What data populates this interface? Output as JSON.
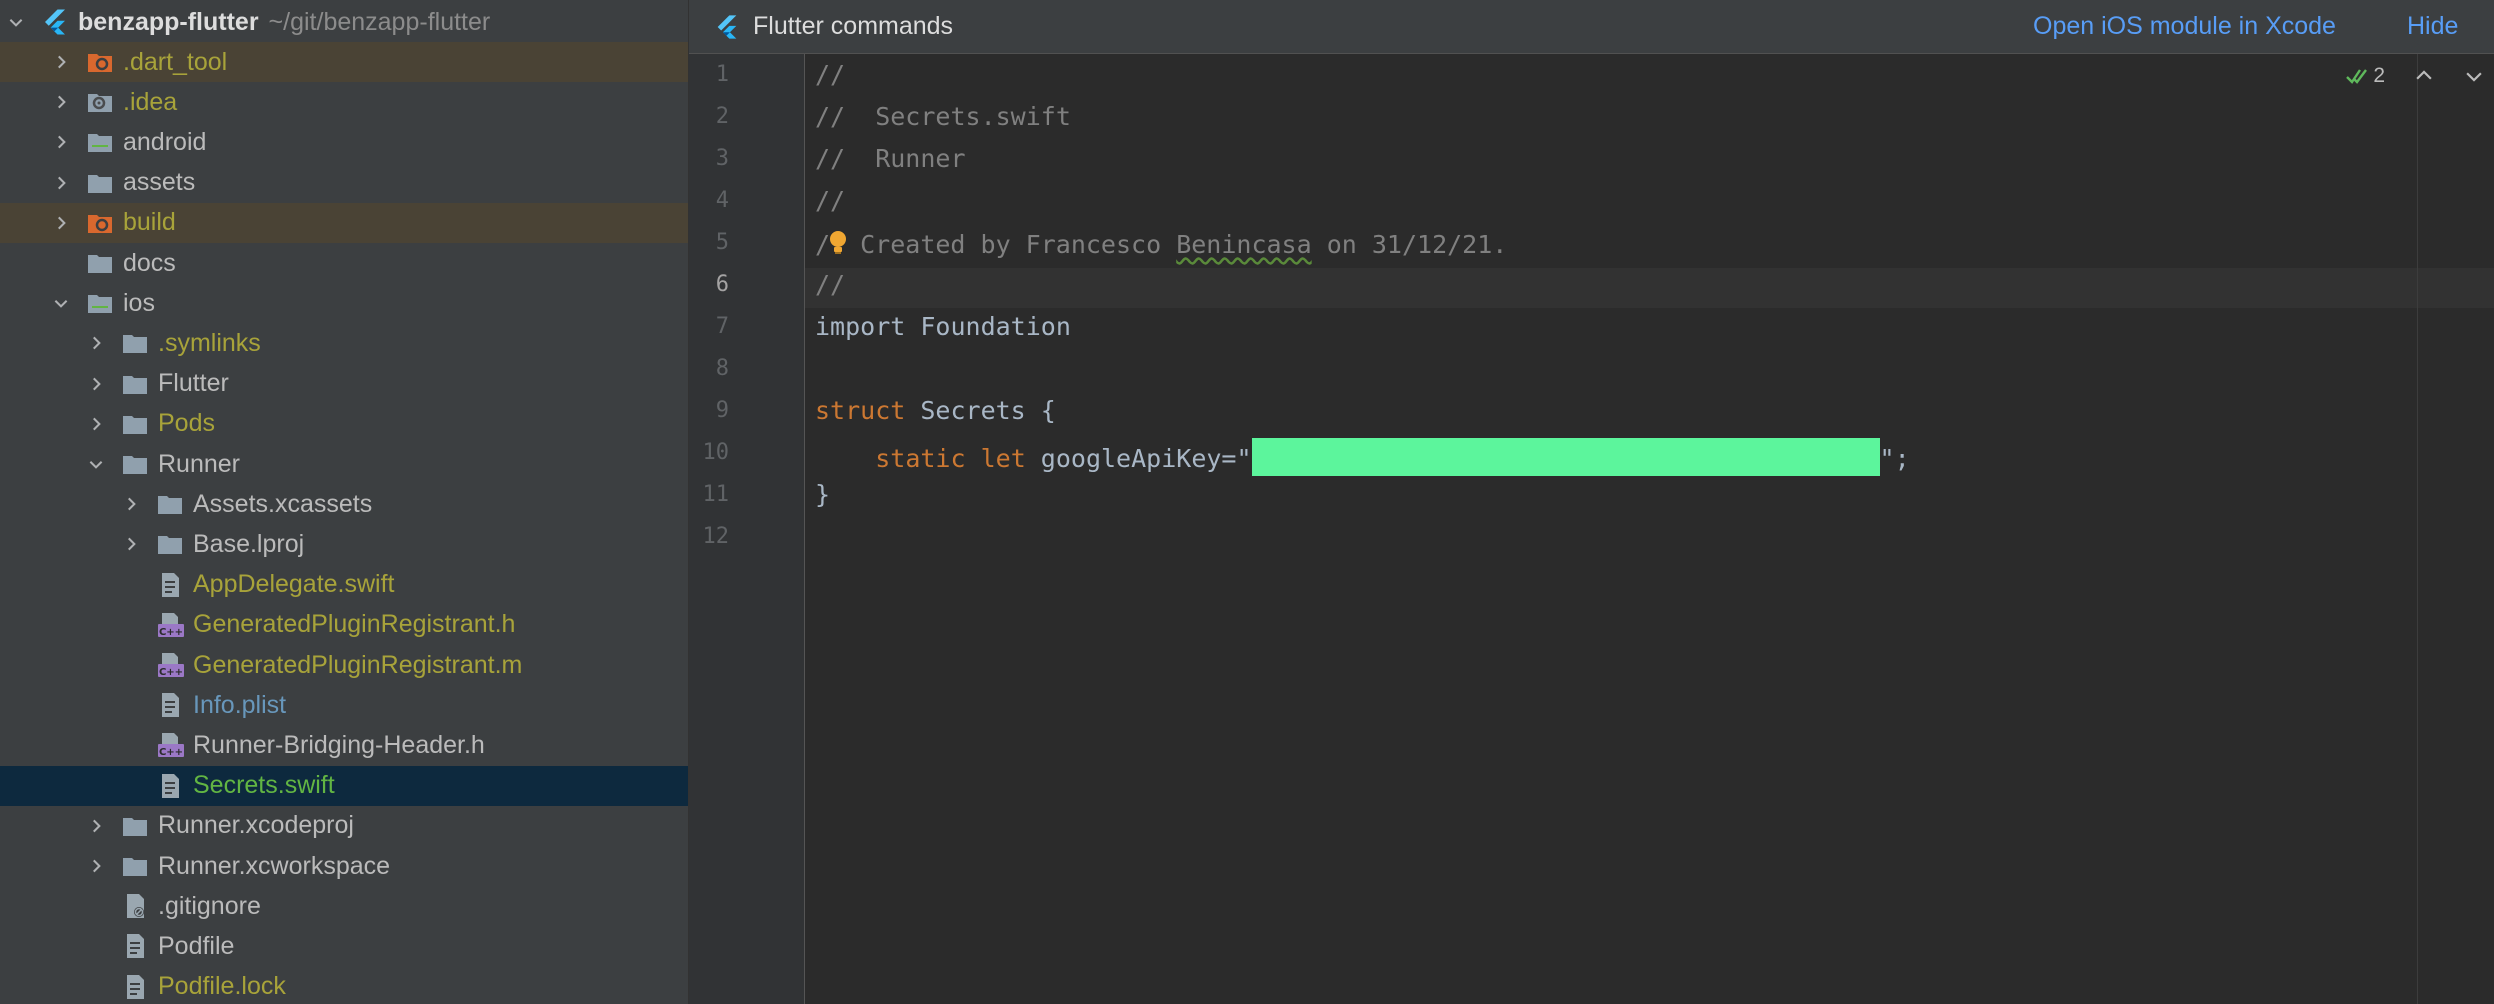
{
  "project": {
    "name": "benzapp-flutter",
    "path": "~/git/benzapp-flutter"
  },
  "tree": [
    {
      "label": ".dart_tool",
      "depth": 1,
      "arrow": "right",
      "icon": "folder-excluded-icon",
      "color": "yellow",
      "ignored": true
    },
    {
      "label": ".idea",
      "depth": 1,
      "arrow": "right",
      "icon": "folder-settings-icon",
      "color": "yellow"
    },
    {
      "label": "android",
      "depth": 1,
      "arrow": "right",
      "icon": "folder-module-icon",
      "color": "default"
    },
    {
      "label": "assets",
      "depth": 1,
      "arrow": "right",
      "icon": "folder-icon",
      "color": "default"
    },
    {
      "label": "build",
      "depth": 1,
      "arrow": "right",
      "icon": "folder-excluded-icon",
      "color": "yellow",
      "ignored": true
    },
    {
      "label": "docs",
      "depth": 1,
      "arrow": "none",
      "icon": "folder-icon",
      "color": "default"
    },
    {
      "label": "ios",
      "depth": 1,
      "arrow": "down",
      "icon": "folder-module-icon",
      "color": "default"
    },
    {
      "label": ".symlinks",
      "depth": 2,
      "arrow": "right",
      "icon": "folder-icon",
      "color": "yellow"
    },
    {
      "label": "Flutter",
      "depth": 2,
      "arrow": "right",
      "icon": "folder-icon",
      "color": "default"
    },
    {
      "label": "Pods",
      "depth": 2,
      "arrow": "right",
      "icon": "folder-icon",
      "color": "yellow"
    },
    {
      "label": "Runner",
      "depth": 2,
      "arrow": "down",
      "icon": "folder-icon",
      "color": "default"
    },
    {
      "label": "Assets.xcassets",
      "depth": 3,
      "arrow": "right",
      "icon": "folder-icon",
      "color": "default"
    },
    {
      "label": "Base.lproj",
      "depth": 3,
      "arrow": "right",
      "icon": "folder-icon",
      "color": "default"
    },
    {
      "label": "AppDelegate.swift",
      "depth": 3,
      "arrow": "none",
      "icon": "file-icon",
      "color": "yellow"
    },
    {
      "label": "GeneratedPluginRegistrant.h",
      "depth": 3,
      "arrow": "none",
      "icon": "cpp-file-icon",
      "color": "yellow"
    },
    {
      "label": "GeneratedPluginRegistrant.m",
      "depth": 3,
      "arrow": "none",
      "icon": "cpp-file-icon",
      "color": "yellow"
    },
    {
      "label": "Info.plist",
      "depth": 3,
      "arrow": "none",
      "icon": "file-icon",
      "color": "blue"
    },
    {
      "label": "Runner-Bridging-Header.h",
      "depth": 3,
      "arrow": "none",
      "icon": "cpp-file-icon",
      "color": "default"
    },
    {
      "label": "Secrets.swift",
      "depth": 3,
      "arrow": "none",
      "icon": "file-icon",
      "color": "green",
      "selected": true
    },
    {
      "label": "Runner.xcodeproj",
      "depth": 2,
      "arrow": "right",
      "icon": "folder-icon",
      "color": "default"
    },
    {
      "label": "Runner.xcworkspace",
      "depth": 2,
      "arrow": "right",
      "icon": "folder-icon",
      "color": "default"
    },
    {
      "label": ".gitignore",
      "depth": 2,
      "arrow": "none",
      "icon": "gitignore-file-icon",
      "color": "default"
    },
    {
      "label": "Podfile",
      "depth": 2,
      "arrow": "none",
      "icon": "file-icon",
      "color": "default"
    },
    {
      "label": "Podfile.lock",
      "depth": 2,
      "arrow": "none",
      "icon": "file-icon",
      "color": "yellow"
    }
  ],
  "banner": {
    "title": "Flutter commands",
    "open_xcode": "Open iOS module in Xcode",
    "hide": "Hide"
  },
  "inspection": {
    "count": "2"
  },
  "editor": {
    "line_numbers": [
      "1",
      "2",
      "3",
      "4",
      "5",
      "6",
      "7",
      "8",
      "9",
      "10",
      "11",
      "12"
    ],
    "current_line": "6",
    "lines": [
      {
        "segments": [
          {
            "t": "//",
            "c": "cmt"
          }
        ]
      },
      {
        "segments": [
          {
            "t": "//  Secrets.swift",
            "c": "cmt"
          }
        ]
      },
      {
        "segments": [
          {
            "t": "//  Runner",
            "c": "cmt"
          }
        ]
      },
      {
        "segments": [
          {
            "t": "//",
            "c": "cmt"
          }
        ]
      },
      {
        "segments": [
          {
            "t": "/",
            "c": "cmt"
          },
          {
            "t": "BULB",
            "c": "bulb"
          },
          {
            "t": " Created by Francesco ",
            "c": "cmt"
          },
          {
            "t": "Benincasa",
            "c": "cmt squig"
          },
          {
            "t": " on 31/12/21.",
            "c": "cmt"
          }
        ]
      },
      {
        "segments": [
          {
            "t": "//",
            "c": "cmt"
          }
        ]
      },
      {
        "segments": [
          {
            "t": "import",
            "c": ""
          },
          {
            "t": " Foundation",
            "c": ""
          }
        ]
      },
      {
        "segments": []
      },
      {
        "segments": [
          {
            "t": "struct",
            "c": "kw"
          },
          {
            "t": " Secrets {",
            "c": ""
          }
        ]
      },
      {
        "segments": [
          {
            "t": "    ",
            "c": ""
          },
          {
            "t": "static",
            "c": "kw"
          },
          {
            "t": " ",
            "c": ""
          },
          {
            "t": "let",
            "c": "kw"
          },
          {
            "t": " googleApiKey=\"",
            "c": ""
          },
          {
            "t": "REDACT",
            "c": "redact"
          },
          {
            "t": "\";",
            "c": ""
          }
        ]
      },
      {
        "segments": [
          {
            "t": "}",
            "c": ""
          }
        ]
      },
      {
        "segments": []
      }
    ],
    "redaction_color": "#5cf59c"
  },
  "colors": {
    "yellow": "#a8a33a",
    "blue": "#6897bb",
    "green": "#62b543",
    "default": "#bbbbbb",
    "link": "#589df6"
  }
}
